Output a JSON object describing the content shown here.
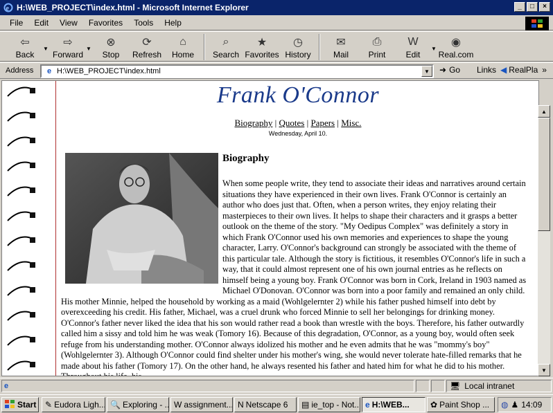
{
  "window": {
    "title": "H:\\WEB_PROJECT\\index.html - Microsoft Internet Explorer",
    "controls": [
      "_",
      "□",
      "×"
    ]
  },
  "menu": [
    "File",
    "Edit",
    "View",
    "Favorites",
    "Tools",
    "Help"
  ],
  "toolbar": {
    "back": "Back",
    "forward": "Forward",
    "stop": "Stop",
    "refresh": "Refresh",
    "home": "Home",
    "search": "Search",
    "favorites": "Favorites",
    "history": "History",
    "mail": "Mail",
    "print": "Print",
    "edit": "Edit",
    "realcom": "Real.com"
  },
  "address": {
    "label": "Address",
    "value": "H:\\WEB_PROJECT\\index.html",
    "go": "Go",
    "links": "Links",
    "realplayer": "RealPla"
  },
  "page": {
    "title": "Frank O'Connor",
    "nav": [
      "Biography",
      "Quotes",
      "Papers",
      "Misc."
    ],
    "nav_sep": "|",
    "date": "Wednesday, April 10.",
    "section_heading": "Biography",
    "paragraph": "When some people write, they tend to associate their ideas and narratives around certain situations they have experienced in their own lives. Frank O'Connor is certainly an author who does just that. Often, when a person writes, they enjoy relating their masterpieces to their own lives. It helps to shape their characters and it grasps a better outlook on the theme of the story. \"My Oedipus Complex\" was definitely a story in which Frank O'Connor used his own memories and experiences to shape the young character, Larry. O'Connor's background can strongly be associated with the theme of this particular tale. Although the story is fictitious, it resembles O'Connor's life in such a way, that it could almost represent one of his own journal entries as he reflects on himself being a young boy. Frank O'Connor was born in Cork, Ireland in 1903 named as Michael O'Donovan. O'Connor was born into a poor family and remained an only child. His mother Minnie, helped the household by working as a maid (Wohlgelernter 2) while his father pushed himself into debt by overexceeding his credit. His father, Michael, was a cruel drunk who forced Minnie to sell her belongings for drinking money. O'Connor's father never liked the idea that his son would rather read a book than wrestle with the boys. Therefore, his father outwardly called him a sissy and told him he was weak (Tomory 16). Because of this degradation, O'Connor, as a young boy, would often seek refuge from his understanding mother. O'Connor always idolized his mother and he even admits that he was \"mommy's boy\" (Wohlgelernter 3). Although O'Connor could find shelter under his mother's wing, she would never tolerate hate-filled remarks that he made about his father (Tomory 17). On the other hand, he always resented his father and hated him for what he did to his mother. Throughout his life, his"
  },
  "status": {
    "zone": "Local intranet"
  },
  "taskbar": {
    "start": "Start",
    "tasks": [
      "Eudora Ligh...",
      "Exploring - ...",
      "assignment...",
      "Netscape 6",
      "ie_top - Not...",
      "H:\\WEB...",
      "Paint Shop ..."
    ],
    "active_index": 5,
    "clock": "14:09"
  },
  "colors": {
    "titlebar": "#0a246a",
    "page_title": "#1a3a8a",
    "margin_line": "#b03030"
  }
}
